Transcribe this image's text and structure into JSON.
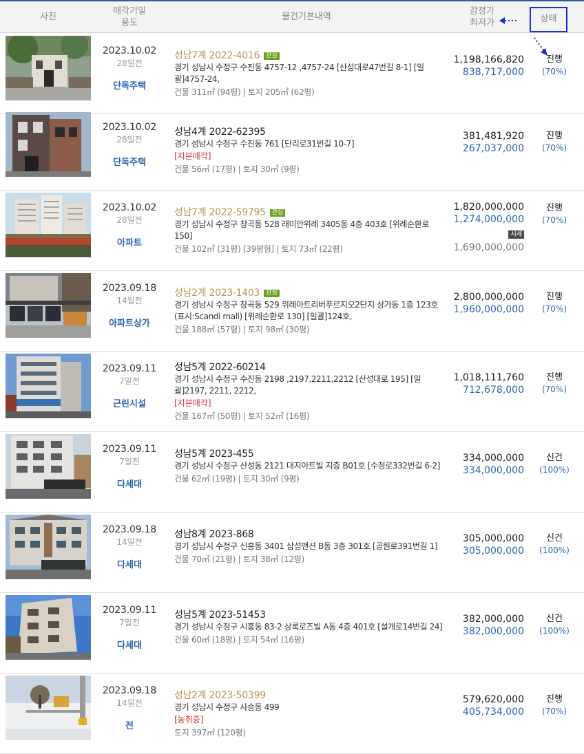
{
  "header": {
    "photo": "사진",
    "date_line1": "매각기일",
    "date_line2": "용도",
    "info": "물건기본내역",
    "price_line1": "감정가",
    "price_line2": "최저가",
    "status": "상태"
  },
  "colors": {
    "accent_blue": "#2d64b3",
    "gold": "#b69451",
    "red": "#d93030",
    "highlight_box": "#1a2fd6"
  },
  "rows": [
    {
      "date": "2023.10.02",
      "ago": "28일전",
      "usage": "단독주택",
      "case": "성남7계 2022-4016",
      "favorite": true,
      "fav_label": "관심",
      "address": "경기 성남시 수정구 수진동 4757-12 ,4757-24 [산성대로47번길 8-1] [일괄]4757-24,",
      "tag": "",
      "area": "건물 311㎡ (94평)   |   토지 205㎡ (62평)",
      "appraisal": "1,198,166,820",
      "minimum": "838,717,000",
      "status": "진행",
      "ratio": "(70%)",
      "photo_icon": "house-photo"
    },
    {
      "date": "2023.10.02",
      "ago": "28일전",
      "usage": "단독주택",
      "case": "성남4계 2022-62395",
      "favorite": false,
      "address": "경기 성남시 수정구 수진동 761 [단리로31번길 10-7]",
      "tag": "[지분매각]",
      "area": "건물 56㎡ (17평)   |   토지 30㎡ (9평)",
      "appraisal": "381,481,920",
      "minimum": "267,037,000",
      "status": "진행",
      "ratio": "(70%)",
      "photo_icon": "brick-building-photo"
    },
    {
      "date": "2023.10.02",
      "ago": "28일전",
      "usage": "아파트",
      "case": "성남7계 2022-59795",
      "favorite": true,
      "fav_label": "관심",
      "address": "경기 성남시 수정구 창곡동 528 래미안위례 3405동 4층 403호 [위례순환로 150]",
      "tag": "",
      "area": "건물 102㎡ (31평) [39평형]   |   토지 73㎡ (22평)",
      "appraisal": "1,820,000,000",
      "minimum": "1,274,000,000",
      "market_label": "시세",
      "market_value": "1,690,000,000",
      "status": "진행",
      "ratio": "(70%)",
      "photo_icon": "apartment-photo"
    },
    {
      "date": "2023.09.18",
      "ago": "14일전",
      "usage": "아파트상가",
      "case": "성남2계 2023-1403",
      "favorite": true,
      "fav_label": "관심",
      "address": "경기 성남시 수정구 창곡동 529 위례아트리버푸르지오2단지 상가동 1층 123호 (표시:Scandi mall) [위례순환로 130]  [일괄]124호,",
      "tag": "",
      "area": "건물 188㎡ (57평)   |   토지 98㎡ (30평)",
      "appraisal": "2,800,000,000",
      "minimum": "1,960,000,000",
      "status": "진행",
      "ratio": "(70%)",
      "photo_icon": "shop-street-photo"
    },
    {
      "date": "2023.09.11",
      "ago": "7일전",
      "usage": "근린시설",
      "case": "성남5계 2022-60214",
      "favorite": false,
      "address": "경기 성남시 수정구 수진동 2198 ,2197,2211,2212 [산성대로 195] [일괄]2197, 2211, 2212,",
      "tag": "[지분매각]",
      "area": "건물 167㎡ (50평)   |   토지 52㎡ (16평)",
      "appraisal": "1,018,111,760",
      "minimum": "712,678,000",
      "status": "진행",
      "ratio": "(70%)",
      "photo_icon": "commercial-building-photo"
    },
    {
      "date": "2023.09.11",
      "ago": "7일전",
      "usage": "다세대",
      "case": "성남5계 2023-455",
      "favorite": false,
      "address": "경기 성남시 수정구 산성동 2121 대지아트빌 지층 B01호 [수정로332번길 6-2]",
      "tag": "",
      "area": "건물 62㎡ (19평)   |   토지 30㎡ (9평)",
      "appraisal": "334,000,000",
      "minimum": "334,000,000",
      "status": "신건",
      "ratio": "(100%)",
      "photo_icon": "villa-photo"
    },
    {
      "date": "2023.09.18",
      "ago": "14일전",
      "usage": "다세대",
      "case": "성남8계 2023-868",
      "favorite": false,
      "address": "경기 성남시 수정구 신흥동 3401 삼성맨션 B동 3층 301호 [공원로391번길 1]",
      "tag": "",
      "area": "건물 70㎡ (21평)   |   토지 38㎡ (12평)",
      "appraisal": "305,000,000",
      "minimum": "305,000,000",
      "status": "신건",
      "ratio": "(100%)",
      "photo_icon": "mansion-photo"
    },
    {
      "date": "2023.09.11",
      "ago": "7일전",
      "usage": "다세대",
      "case": "성남5계 2023-51453",
      "favorite": false,
      "address": "경기 성남시 수정구 시흥동 83-2 상록로즈빌 A동 4층 401호 [설개로14번길 24]",
      "tag": "",
      "area": "건물 60㎡ (18평)   |   토지 54㎡ (16평)",
      "appraisal": "382,000,000",
      "minimum": "382,000,000",
      "status": "신건",
      "ratio": "(100%)",
      "photo_icon": "villa-sky-photo"
    },
    {
      "date": "2023.09.18",
      "ago": "14일전",
      "usage": "전",
      "case": "성남2계 2023-50399",
      "favorite": false,
      "gold_case": true,
      "address": "경기 성남시 수정구 사송동 499",
      "tag": "[농취증]",
      "area": "토지 397㎡ (120평)",
      "appraisal": "579,620,000",
      "minimum": "405,734,000",
      "status": "진행",
      "ratio": "(70%)",
      "photo_icon": "snow-field-photo"
    }
  ]
}
